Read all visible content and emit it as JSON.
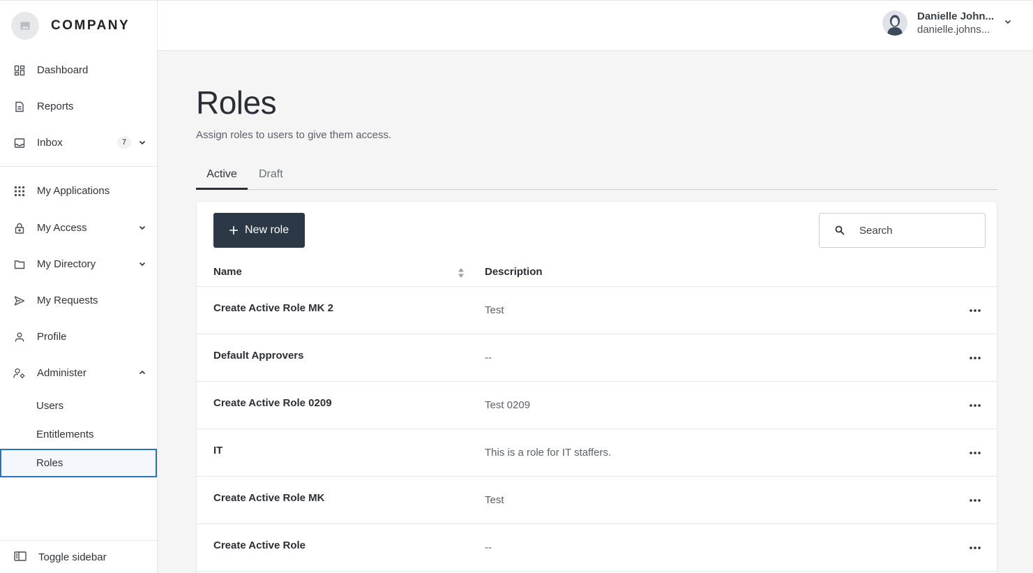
{
  "brand": {
    "name": "COMPANY"
  },
  "sidebar": {
    "items": [
      {
        "label": "Dashboard"
      },
      {
        "label": "Reports"
      },
      {
        "label": "Inbox",
        "badge": "7"
      },
      {
        "label": "My Applications"
      },
      {
        "label": "My Access"
      },
      {
        "label": "My Directory"
      },
      {
        "label": "My Requests"
      },
      {
        "label": "Profile"
      },
      {
        "label": "Administer"
      }
    ],
    "sub_items": [
      {
        "label": "Users"
      },
      {
        "label": "Entitlements"
      },
      {
        "label": "Roles"
      }
    ],
    "toggle_label": "Toggle sidebar"
  },
  "user": {
    "name": "Danielle John...",
    "email": "danielle.johns..."
  },
  "page": {
    "title": "Roles",
    "subtitle": "Assign roles to users to give them access."
  },
  "tabs": [
    {
      "label": "Active"
    },
    {
      "label": "Draft"
    }
  ],
  "toolbar": {
    "new_label": "New role",
    "search_placeholder": "Search"
  },
  "table": {
    "columns": [
      "Name",
      "Description"
    ],
    "rows": [
      {
        "name": "Create Active Role MK 2",
        "description": "Test"
      },
      {
        "name": "Default Approvers",
        "description": "--"
      },
      {
        "name": "Create Active Role 0209",
        "description": "Test 0209"
      },
      {
        "name": "IT",
        "description": "This is a role for IT staffers."
      },
      {
        "name": "Create Active Role MK",
        "description": "Test"
      },
      {
        "name": "Create Active Role",
        "description": "--"
      }
    ]
  },
  "colors": {
    "primary_button": "#2d3846",
    "active_outline": "#2b73b6"
  }
}
